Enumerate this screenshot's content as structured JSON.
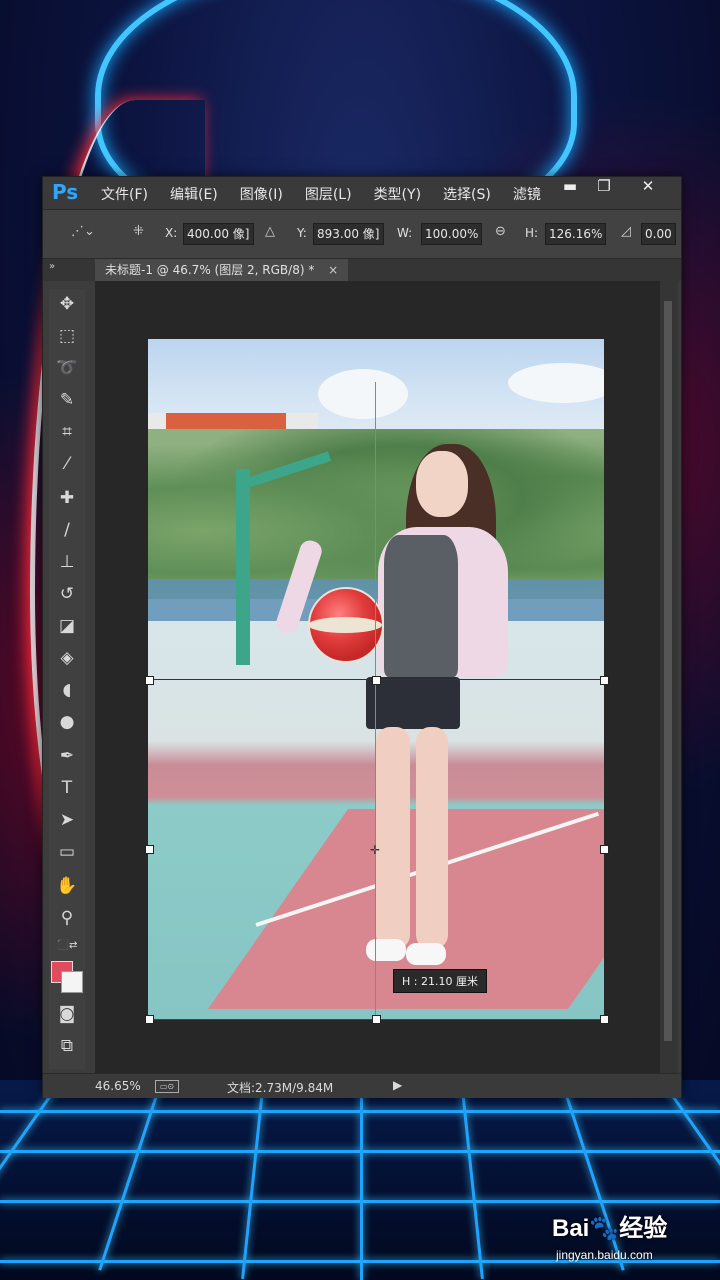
{
  "app": {
    "logo": "Ps",
    "menus": [
      "文件(F)",
      "编辑(E)",
      "图像(I)",
      "图层(L)",
      "类型(Y)",
      "选择(S)",
      "滤镜"
    ],
    "window_buttons": [
      "▬",
      "❐",
      "✕"
    ]
  },
  "options": {
    "x_label": "X:",
    "x_value": "400.00 像]",
    "y_label": "Y:",
    "y_value": "893.00 像]",
    "w_label": "W:",
    "w_value": "100.00%",
    "h_label": "H:",
    "h_value": "126.16%",
    "angle_value": "0.00"
  },
  "document": {
    "tab_title": "未标题-1 @ 46.7% (图层 2, RGB/8) *",
    "tab_close": "×"
  },
  "tooltip": {
    "text": "H : 21.10 厘米"
  },
  "status": {
    "zoom": "46.65%",
    "doc_size": "文档:2.73M/9.84M",
    "arrow": "▶"
  },
  "watermark": {
    "logo": "Bai🐾经验",
    "url": "jingyan.baidu.com"
  },
  "colors": {
    "foreground": "#e04c5c",
    "background": "#f4f4f4",
    "ps_accent": "#2ea6ff"
  },
  "tools": [
    "move-icon",
    "marquee-icon",
    "lasso-icon",
    "quick-select-icon",
    "crop-icon",
    "eyedropper-icon",
    "healing-brush-icon",
    "brush-icon",
    "clone-stamp-icon",
    "history-brush-icon",
    "eraser-icon",
    "paint-bucket-icon",
    "blur-icon",
    "dodge-icon",
    "pen-icon",
    "type-icon",
    "path-select-icon",
    "rectangle-icon",
    "hand-icon",
    "zoom-icon"
  ]
}
